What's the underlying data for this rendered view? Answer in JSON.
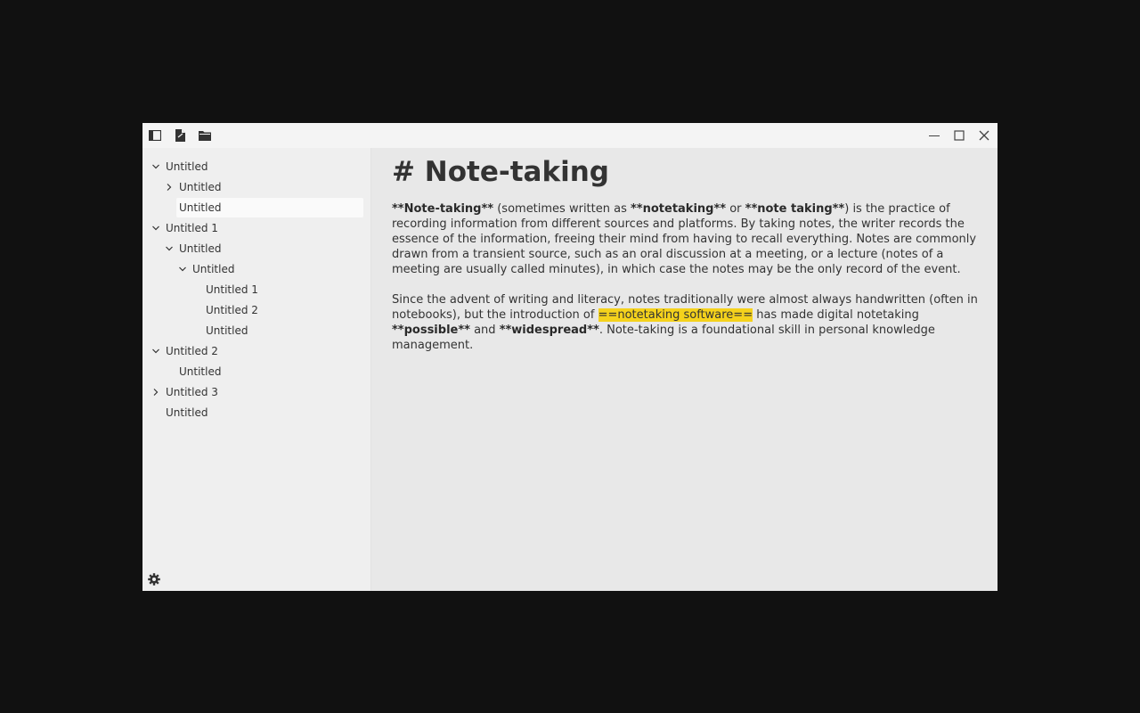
{
  "toolbar": {
    "icons": [
      "sidebar-toggle-icon",
      "new-note-icon",
      "folder-icon"
    ],
    "window_controls": [
      "minimize-icon",
      "maximize-icon",
      "close-icon"
    ]
  },
  "sidebar": {
    "tree": [
      {
        "label": "Untitled",
        "chevron": "down"
      },
      {
        "label": "Untitled",
        "chevron": "right"
      },
      {
        "label": "Untitled",
        "chevron": "none",
        "selected": true
      },
      {
        "label": "Untitled 1",
        "chevron": "down"
      },
      {
        "label": "Untitled",
        "chevron": "down"
      },
      {
        "label": "Untitled",
        "chevron": "down"
      },
      {
        "label": "Untitled 1",
        "chevron": "none"
      },
      {
        "label": "Untitled 2",
        "chevron": "none"
      },
      {
        "label": "Untitled",
        "chevron": "none"
      },
      {
        "label": "Untitled 2",
        "chevron": "down"
      },
      {
        "label": "Untitled",
        "chevron": "none"
      },
      {
        "label": "Untitled 3",
        "chevron": "right"
      },
      {
        "label": "Untitled",
        "chevron": "none"
      }
    ],
    "settings_icon": "gear-icon"
  },
  "document": {
    "heading": "# Note-taking",
    "p1": {
      "s1": "**Note-taking**",
      "s2": " (sometimes written as ",
      "s3": "**notetaking**",
      "s4": " or ",
      "s5": "**note taking**",
      "s6": ") is the practice of recording information from different sources and platforms. By taking notes, the writer records the essence of the information, freeing their mind from having to recall everything. Notes are commonly drawn from a transient source, such as an oral discussion at a meeting, or a lecture (notes of a meeting are usually called minutes), in which case the notes may be the only record of the event."
    },
    "p2": {
      "s1": "Since the advent of writing and literacy, notes traditionally were almost always handwritten (often in notebooks), but the introduction of ",
      "s2": "==notetaking software==",
      "s3": " has made digital notetaking ",
      "s4": "**possible**",
      "s5": " and ",
      "s6": "**widespread**",
      "s7": ". Note-taking is a foundational skill in personal knowledge management."
    },
    "highlight_color": "#f5d21c"
  }
}
